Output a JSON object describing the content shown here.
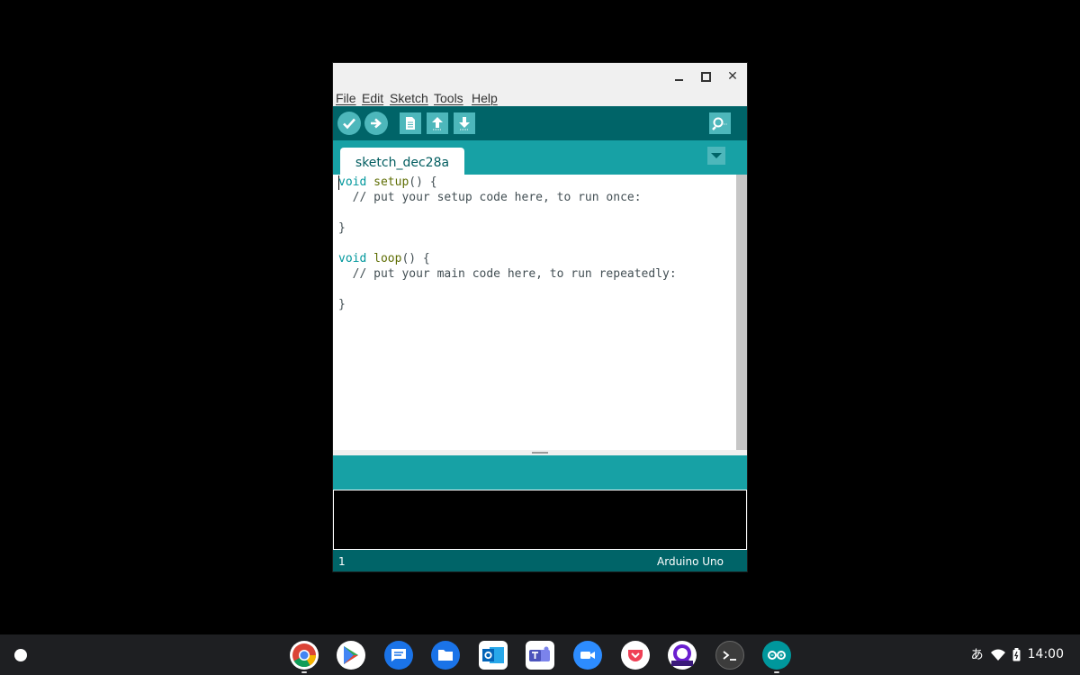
{
  "window": {
    "controls": {
      "minimize": "",
      "maximize": "",
      "close": "✕"
    },
    "menu": [
      "File",
      "Edit",
      "Sketch",
      "Tools",
      "Help"
    ],
    "toolbar": {
      "verify_icon": "check-icon",
      "upload_icon": "arrow-right-icon",
      "new_icon": "new-file-icon",
      "open_icon": "arrow-up-icon",
      "save_icon": "arrow-down-icon",
      "serial_monitor_icon": "magnifier-icon"
    },
    "tab": {
      "name": "sketch_dec28a"
    },
    "code": {
      "line1_kw": "void",
      "line1_fn": "setup",
      "line1_rest": "() {",
      "line2": "  // put your setup code here, to run once:",
      "line4": "}",
      "line6_kw": "void",
      "line6_fn": "loop",
      "line6_rest": "() {",
      "line7": "  // put your main code here, to run repeatedly:",
      "line9": "}"
    },
    "footer": {
      "line_number": "1",
      "board": "Arduino Uno"
    }
  },
  "shelf": {
    "apps": [
      "chrome-icon",
      "play-store-icon",
      "messages-icon",
      "files-icon",
      "outlook-icon",
      "teams-icon",
      "zoom-icon",
      "pocket-icon",
      "app-q-icon",
      "terminal-icon",
      "arduino-icon"
    ],
    "tray": {
      "ime": "あ",
      "time": "14:00"
    }
  },
  "colors": {
    "arduino_dark": "#006468",
    "arduino_teal": "#17a1a5",
    "arduino_light": "#4db7bb"
  }
}
